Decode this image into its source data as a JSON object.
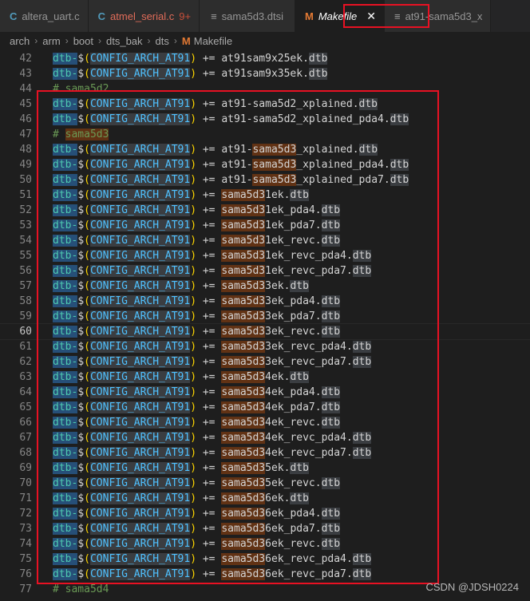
{
  "tabs": [
    {
      "icon": "C",
      "label": "altera_uart.c",
      "kind": "c"
    },
    {
      "icon": "C",
      "label": "atmel_serial.c",
      "kind": "c",
      "badge": "9+"
    },
    {
      "icon": "≡",
      "label": "sama5d3.dtsi",
      "kind": "lines"
    },
    {
      "icon": "M",
      "label": "Makefile",
      "kind": "m",
      "close": "✕"
    },
    {
      "icon": "≡",
      "label": "at91-sama5d3_x",
      "kind": "lines"
    }
  ],
  "breadcrumb": [
    "arch",
    "arm",
    "boot",
    "dts_bak",
    "dts",
    "Makefile"
  ],
  "breadcrumb_sep": "›",
  "lines": [
    {
      "n": "42",
      "type": "rule",
      "file": "at91sam9x25ek.dtb"
    },
    {
      "n": "43",
      "type": "rule",
      "file": "at91sam9x35ek.dtb"
    },
    {
      "n": "44",
      "type": "comment",
      "text": "# sama5d2"
    },
    {
      "n": "45",
      "type": "rule",
      "file": "at91-sama5d2_xplained.dtb"
    },
    {
      "n": "46",
      "type": "rule",
      "file": "at91-sama5d2_xplained_pda4.dtb"
    },
    {
      "n": "47",
      "type": "comment",
      "text": "# sama5d3"
    },
    {
      "n": "48",
      "type": "rule",
      "file": "at91-sama5d3_xplained.dtb"
    },
    {
      "n": "49",
      "type": "rule",
      "file": "at91-sama5d3_xplained_pda4.dtb"
    },
    {
      "n": "50",
      "type": "rule",
      "file": "at91-sama5d3_xplained_pda7.dtb"
    },
    {
      "n": "51",
      "type": "rule",
      "file": "sama5d31ek.dtb"
    },
    {
      "n": "52",
      "type": "rule",
      "file": "sama5d31ek_pda4.dtb"
    },
    {
      "n": "53",
      "type": "rule",
      "file": "sama5d31ek_pda7.dtb"
    },
    {
      "n": "54",
      "type": "rule",
      "file": "sama5d31ek_revc.dtb"
    },
    {
      "n": "55",
      "type": "rule",
      "file": "sama5d31ek_revc_pda4.dtb"
    },
    {
      "n": "56",
      "type": "rule",
      "file": "sama5d31ek_revc_pda7.dtb"
    },
    {
      "n": "57",
      "type": "rule",
      "file": "sama5d33ek.dtb"
    },
    {
      "n": "58",
      "type": "rule",
      "file": "sama5d33ek_pda4.dtb"
    },
    {
      "n": "59",
      "type": "rule",
      "file": "sama5d33ek_pda7.dtb"
    },
    {
      "n": "60",
      "type": "rule",
      "file": "sama5d33ek_revc.dtb",
      "current": true
    },
    {
      "n": "61",
      "type": "rule",
      "file": "sama5d33ek_revc_pda4.dtb"
    },
    {
      "n": "62",
      "type": "rule",
      "file": "sama5d33ek_revc_pda7.dtb"
    },
    {
      "n": "63",
      "type": "rule",
      "file": "sama5d34ek.dtb"
    },
    {
      "n": "64",
      "type": "rule",
      "file": "sama5d34ek_pda4.dtb"
    },
    {
      "n": "65",
      "type": "rule",
      "file": "sama5d34ek_pda7.dtb"
    },
    {
      "n": "66",
      "type": "rule",
      "file": "sama5d34ek_revc.dtb"
    },
    {
      "n": "67",
      "type": "rule",
      "file": "sama5d34ek_revc_pda4.dtb"
    },
    {
      "n": "68",
      "type": "rule",
      "file": "sama5d34ek_revc_pda7.dtb"
    },
    {
      "n": "69",
      "type": "rule",
      "file": "sama5d35ek.dtb"
    },
    {
      "n": "70",
      "type": "rule",
      "file": "sama5d35ek_revc.dtb"
    },
    {
      "n": "71",
      "type": "rule",
      "file": "sama5d36ek.dtb"
    },
    {
      "n": "72",
      "type": "rule",
      "file": "sama5d36ek_pda4.dtb"
    },
    {
      "n": "73",
      "type": "rule",
      "file": "sama5d36ek_pda7.dtb"
    },
    {
      "n": "74",
      "type": "rule",
      "file": "sama5d36ek_revc.dtb"
    },
    {
      "n": "75",
      "type": "rule",
      "file": "sama5d36ek_revc_pda4.dtb"
    },
    {
      "n": "76",
      "type": "rule",
      "file": "sama5d36ek_revc_pda7.dtb"
    },
    {
      "n": "77",
      "type": "comment",
      "text": "# sama5d4"
    }
  ],
  "rule_prefix": {
    "var": "dtb-",
    "dollar": "$",
    "open": "(",
    "config": "CONFIG_ARCH_AT91",
    "close": ")",
    "op": " += "
  },
  "search_term": "sama5d3",
  "watermark": "CSDN @JDSH0224",
  "colors": {
    "highlight_border": "#e81123",
    "accent_makefile": "#e37933",
    "accent_c": "#519aba"
  }
}
